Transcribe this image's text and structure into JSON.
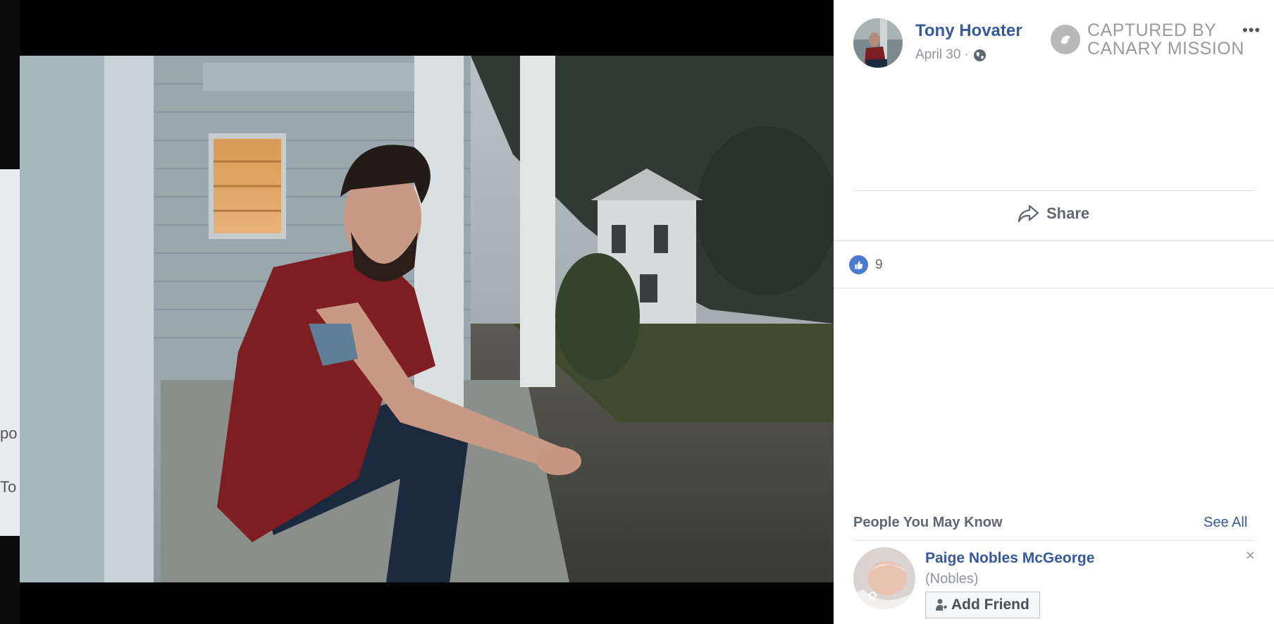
{
  "post": {
    "author_name": "Tony Hovater",
    "date": "April 30",
    "separator": "·",
    "privacy_icon": "globe-icon"
  },
  "watermark": {
    "line1": "CAPTURED BY",
    "line2": "CANARY MISSION"
  },
  "actions": {
    "more_label": "•••",
    "share_label": "Share"
  },
  "reactions": {
    "like_count": "9"
  },
  "background_fragments": {
    "frag1": "po",
    "frag2": "To"
  },
  "people_you_may_know": {
    "title": "People You May Know",
    "see_all": "See All",
    "items": [
      {
        "name": "Paige Nobles McGeorge",
        "subtitle": "(Nobles)",
        "button_label": "Add Friend",
        "close_label": "×"
      }
    ]
  },
  "colors": {
    "link": "#385898",
    "like_blue": "#4a7bd0",
    "muted": "#90949c"
  }
}
